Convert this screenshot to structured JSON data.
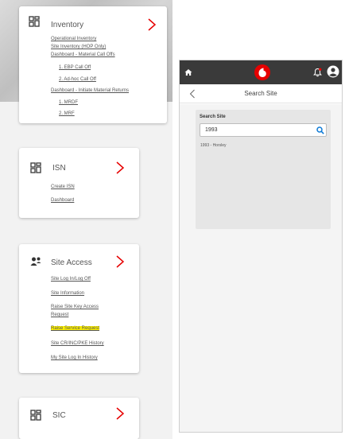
{
  "inventory": {
    "title": "Inventory",
    "links": [
      "Operational Inventory",
      "Site Inventory (HOP Only)",
      "Dashboard - Material Call Offs",
      "1. EBP Call Off",
      "2. Ad-hoc Call Off",
      "Dashboard - Initiate Material Returns",
      "1. MRDF",
      "2. MRF"
    ]
  },
  "isn": {
    "title": "ISN",
    "links": [
      "Create ISN",
      "Dashboard"
    ]
  },
  "site_access": {
    "title": "Site Access",
    "links": [
      "Site Log In/Log Off",
      "Site Information",
      "Raise Site Key Access",
      "Request",
      "Raise Service Request",
      "Site CR/INC/PKE History",
      "My Site Log In History"
    ]
  },
  "sic": {
    "title": "SIC"
  },
  "phone": {
    "page_title": "Search Site",
    "search_label": "Search Site",
    "search_value": "1993",
    "results": [
      "1993 - Horsley"
    ]
  },
  "colors": {
    "topbar": "#3a3a3a",
    "brand_red": "#e60000",
    "accent_blue": "#0d7ad6",
    "highlight": "#fff200"
  }
}
